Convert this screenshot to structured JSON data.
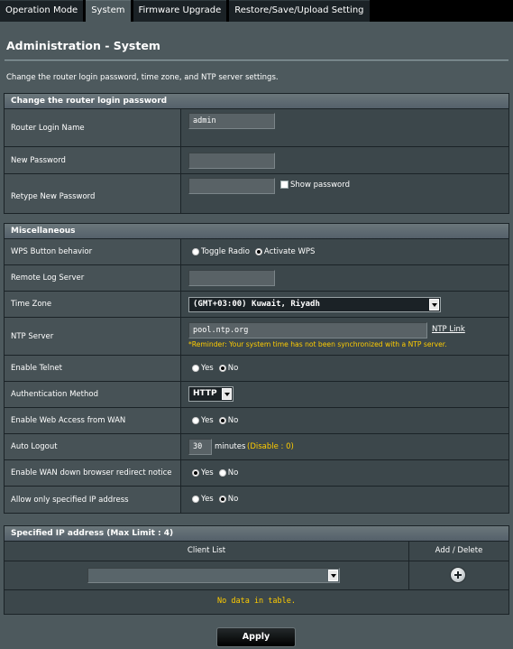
{
  "tabs": [
    "Operation Mode",
    "System",
    "Firmware Upgrade",
    "Restore/Save/Upload Setting"
  ],
  "active_tab": "System",
  "page_title": "Administration - System",
  "description": "Change the router login password, time zone, and NTP server settings.",
  "login_section": {
    "header": "Change the router login password",
    "login_name_label": "Router Login Name",
    "login_name_value": "admin",
    "new_password_label": "New Password",
    "retype_password_label": "Retype New Password",
    "show_password_label": "Show password"
  },
  "misc_section": {
    "header": "Miscellaneous",
    "wps_label": "WPS Button behavior",
    "wps_options": [
      "Toggle Radio",
      "Activate WPS"
    ],
    "remote_log_label": "Remote Log Server",
    "time_zone_label": "Time Zone",
    "time_zone_value": "(GMT+03:00) Kuwait, Riyadh",
    "ntp_label": "NTP Server",
    "ntp_value": "pool.ntp.org",
    "ntp_link": "NTP Link",
    "ntp_reminder": "*Reminder: Your system time has not been synchronized with a NTP server.",
    "telnet_label": "Enable Telnet",
    "auth_label": "Authentication Method",
    "auth_value": "HTTP",
    "wan_access_label": "Enable Web Access from WAN",
    "auto_logout_label": "Auto Logout",
    "auto_logout_value": "30",
    "auto_logout_unit": "minutes",
    "auto_logout_hint": "(Disable : 0)",
    "wan_redirect_label": "Enable WAN down browser redirect notice",
    "allow_ip_label": "Allow only specified IP address",
    "yes": "Yes",
    "no": "No"
  },
  "ip_section": {
    "header": "Specified IP address (Max Limit : 4)",
    "col_client": "Client List",
    "col_add_delete": "Add / Delete",
    "empty_text": "No data in table."
  },
  "apply_label": "Apply",
  "colors": {
    "background": "#4d595d",
    "warning": "#ffcc00"
  }
}
